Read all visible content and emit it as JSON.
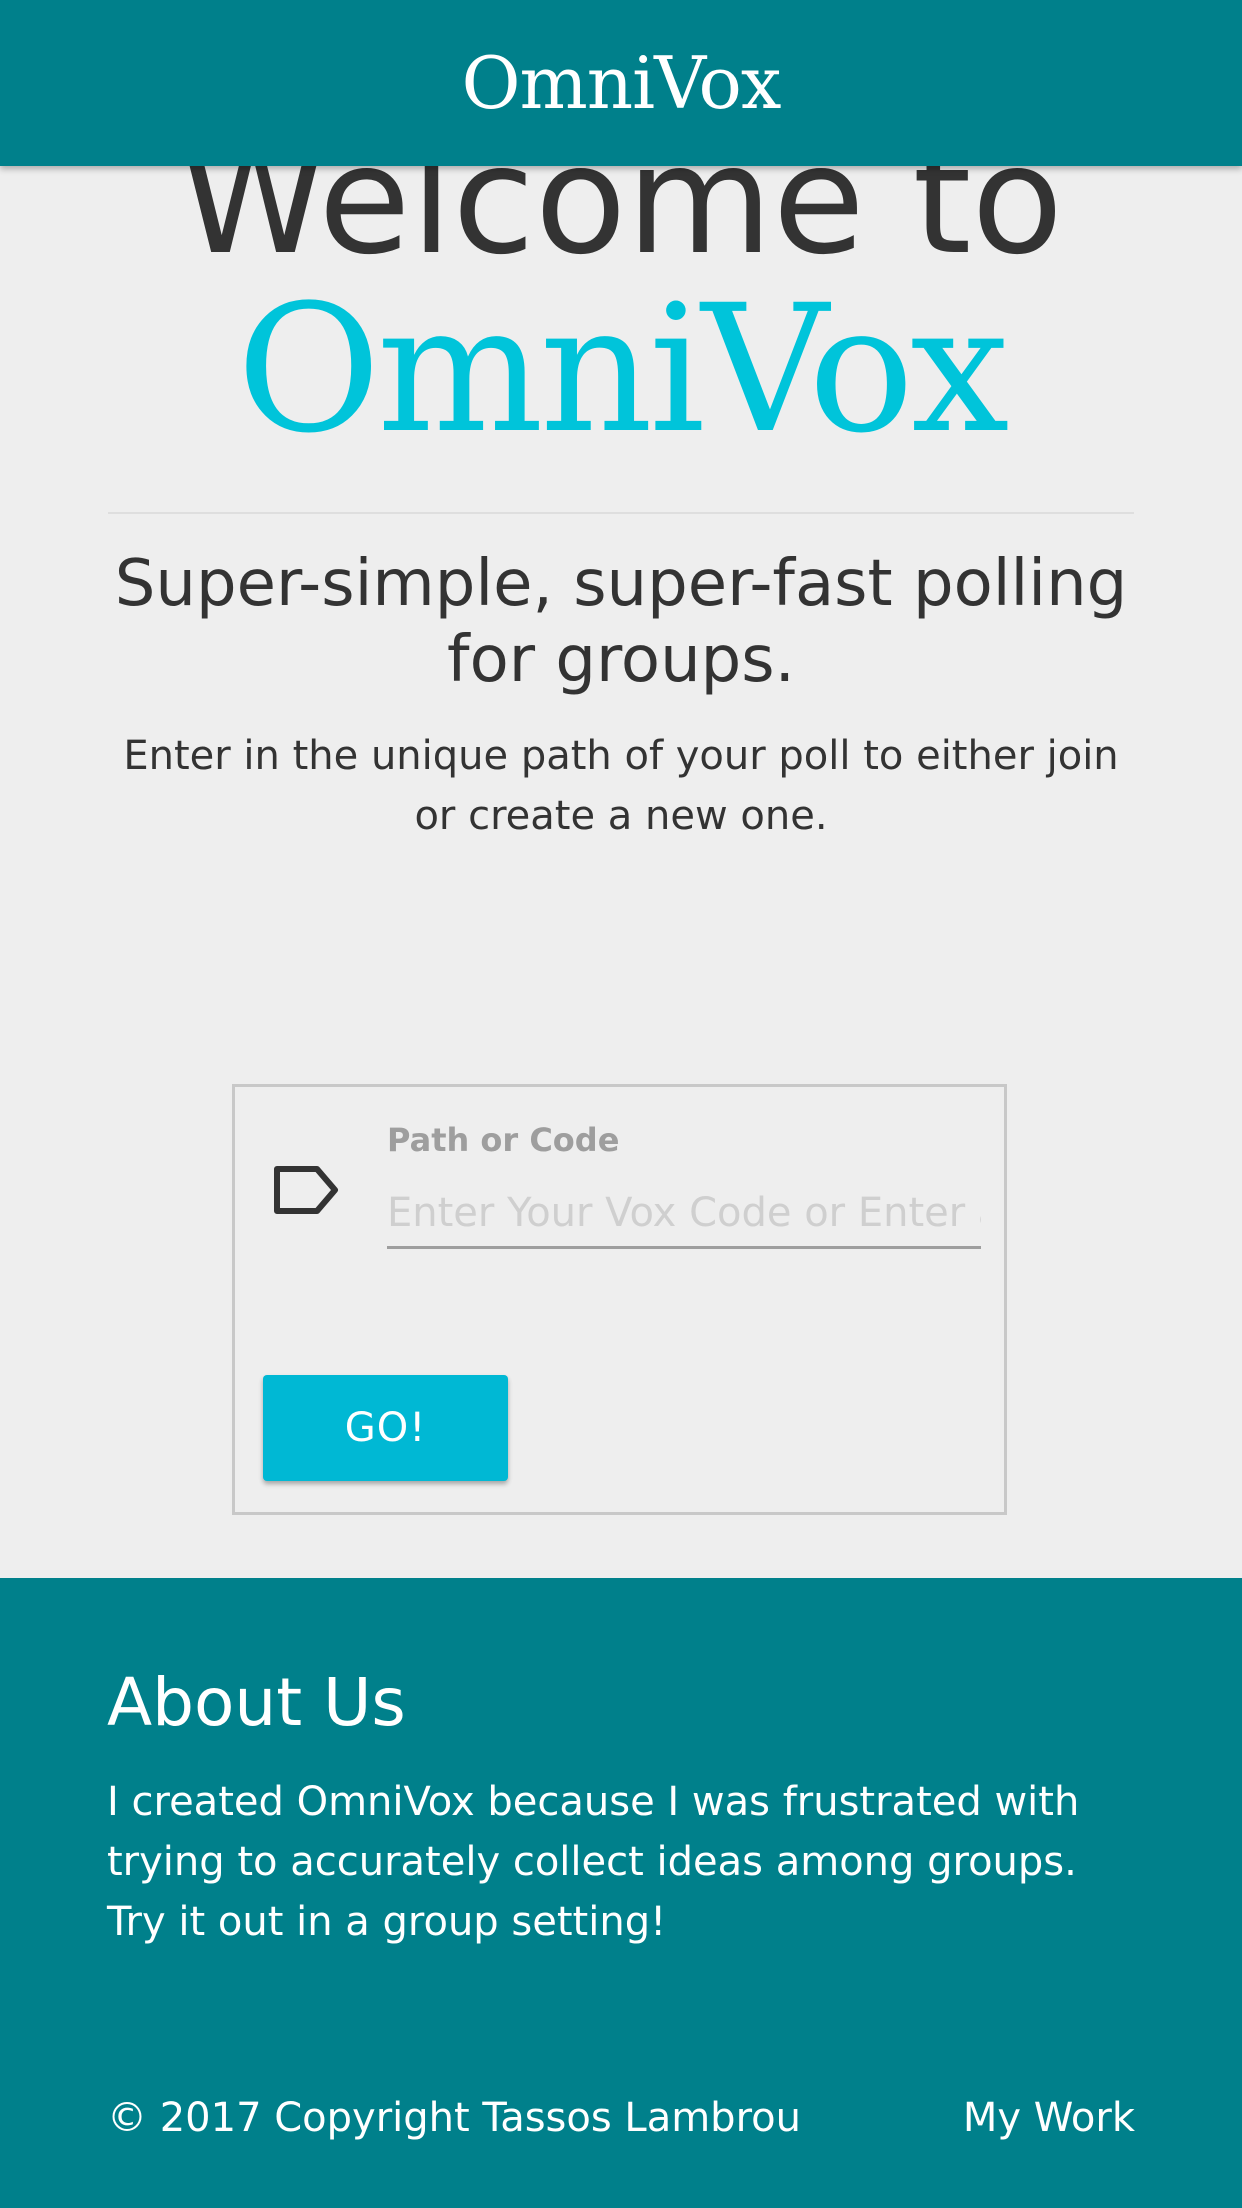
{
  "header": {
    "brand": "OmniVox"
  },
  "hero": {
    "welcome_line": "Welcome to",
    "brand_line": "OmniVox",
    "tagline": "Super-simple, super-fast polling for groups.",
    "instructions": "Enter in the unique path of your poll to either join or create a new one."
  },
  "form": {
    "icon": "tag-icon",
    "field_label": "Path or Code",
    "field_placeholder": "Enter Your Vox Code or Enter a new path",
    "field_value": "",
    "submit_label": "GO!"
  },
  "footer": {
    "about_title": "About Us",
    "about_text": "I created OmniVox because I was frustrated with trying to accurately collect ideas among groups. Try it out in a group setting!",
    "copyright": "© 2017 Copyright Tassos Lambrou",
    "my_work_link": "My Work"
  },
  "colors": {
    "primary_teal": "#00808b",
    "accent_cyan": "#00c4da",
    "button_cyan": "#00b8d4",
    "background": "#eeeeee",
    "text_dark": "#333333"
  }
}
